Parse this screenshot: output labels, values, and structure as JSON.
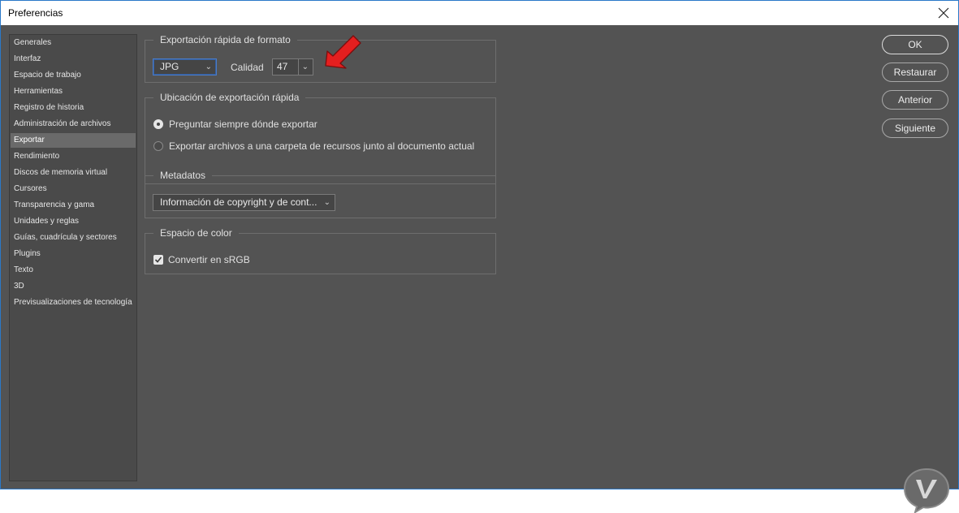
{
  "window": {
    "title": "Preferencias"
  },
  "sidebar": {
    "items": [
      {
        "label": "Generales"
      },
      {
        "label": "Interfaz"
      },
      {
        "label": "Espacio de trabajo"
      },
      {
        "label": "Herramientas"
      },
      {
        "label": "Registro de historia"
      },
      {
        "label": "Administración de archivos"
      },
      {
        "label": "Exportar",
        "selected": true
      },
      {
        "label": "Rendimiento"
      },
      {
        "label": "Discos de memoria virtual"
      },
      {
        "label": "Cursores"
      },
      {
        "label": "Transparencia y gama"
      },
      {
        "label": "Unidades y reglas"
      },
      {
        "label": "Guías, cuadrícula y sectores"
      },
      {
        "label": "Plugins"
      },
      {
        "label": "Texto"
      },
      {
        "label": "3D"
      },
      {
        "label": "Previsualizaciones de tecnología"
      }
    ]
  },
  "quick_export_format": {
    "legend": "Exportación rápida de formato",
    "format_value": "JPG",
    "quality_label": "Calidad",
    "quality_value": "47"
  },
  "quick_export_location": {
    "legend": "Ubicación de exportación rápida",
    "options": [
      {
        "label": "Preguntar siempre dónde exportar",
        "checked": true
      },
      {
        "label": "Exportar archivos a una carpeta de recursos junto al documento actual",
        "checked": false
      }
    ]
  },
  "metadata": {
    "legend": "Metadatos",
    "value": "Información de copyright y de cont..."
  },
  "color_space": {
    "legend": "Espacio de color",
    "checkbox_label": "Convertir en sRGB",
    "checked": true
  },
  "buttons": {
    "ok": "OK",
    "reset": "Restaurar",
    "prev": "Anterior",
    "next": "Siguiente"
  },
  "colors": {
    "background": "#535353",
    "accent_focus": "#4a7cc9",
    "annotation_arrow": "#e41f1f"
  }
}
